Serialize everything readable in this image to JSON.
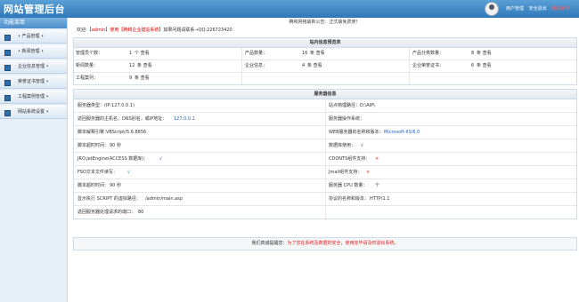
{
  "header": {
    "title": "网站管理后台",
    "nav": [
      "用户管理",
      "安全退出"
    ],
    "nav_danger": "删除缓存"
  },
  "sidebar": {
    "title": "功能菜单",
    "items": [
      "• 产品管理 •",
      "• 新闻管理 •",
      "企业信息管理 •",
      "荣誉证书管理 •",
      "工程案例管理 •",
      "网站系统设置 •"
    ]
  },
  "main": {
    "notice": "腾和网络最新公告：正式版免费使!",
    "welcome_prefix": "欢迎:",
    "welcome_user": "【admin】使用【腾和企业建站系统】",
    "welcome_suffix": "如果问题请联系→QQ:226723420"
  },
  "stats": {
    "title": "站内信息预览表",
    "rows": [
      [
        {
          "label": "管理员个数：",
          "value": "1",
          "unit": "个 查看"
        },
        {
          "label": "产品数量：",
          "value": "16",
          "unit": "条 查看"
        },
        {
          "label": "产品分类数量：",
          "value": "8",
          "unit": "条 查看"
        }
      ],
      [
        {
          "label": "新闻数量：",
          "value": "12",
          "unit": "条 查看"
        },
        {
          "label": "企业信息：",
          "value": "4",
          "unit": "条 查看"
        },
        {
          "label": "企业荣誉证书：",
          "value": "6",
          "unit": "条 查看"
        }
      ],
      [
        {
          "label": "工程案列：",
          "value": "9",
          "unit": "条 查看"
        }
      ]
    ]
  },
  "server": {
    "title": "服务器信息",
    "rows": [
      [
        {
          "label": "服务器类型：(IP:127.0.0.1)",
          "value": ""
        },
        {
          "label": "站点物理路径：D:\\AIP\\",
          "value": ""
        }
      ],
      [
        {
          "label": "返回服务器的主机名、DNS别名，或IP地址：",
          "value": "127.0.0.1"
        },
        {
          "label": "服务器操作系统：",
          "value": ""
        }
      ],
      [
        {
          "label": "脚本解释引擎：",
          "value": "VBScript/5.6.8856"
        },
        {
          "label": "WEB服务器的名称和版本：",
          "value": "Microsoft-IIS/6.0"
        }
      ],
      [
        {
          "label": "脚本超时时间：",
          "value": "90 秒"
        },
        {
          "label": "数据库使用：",
          "value": "√"
        }
      ],
      [
        {
          "label": "JRO.JetEngine(ACCESS 数据库)：",
          "value": "√"
        },
        {
          "label": "CDONTS组件支持：",
          "value": "×"
        }
      ],
      [
        {
          "label": "FSO文本文件读写：",
          "value": "√"
        },
        {
          "label": "Jmail组件支持：",
          "value": "×"
        }
      ],
      [
        {
          "label": "脚本超时时间：",
          "value": "90 秒"
        },
        {
          "label": "服务器 CPU 数量：",
          "value": "个"
        }
      ],
      [
        {
          "label": "显示执行 SCRIPT 的虚拟路径：",
          "value": "/admin/main.asp"
        },
        {
          "label": "协议的名称和版本：",
          "value": "HTTP/1.1"
        }
      ],
      [
        {
          "label": "返回服务器处理请求的端口：",
          "value": "80"
        },
        {
          "label": "",
          "value": ""
        }
      ]
    ]
  },
  "footer": {
    "prefix": "我们真诚提醒您：",
    "text": "为了您在系统及数据的安全，使用完毕请及时退出系统。"
  },
  "colors": {
    "topbar": "#2f77b8",
    "link_blue": "#1f5fc0",
    "danger_red": "#e02020"
  }
}
